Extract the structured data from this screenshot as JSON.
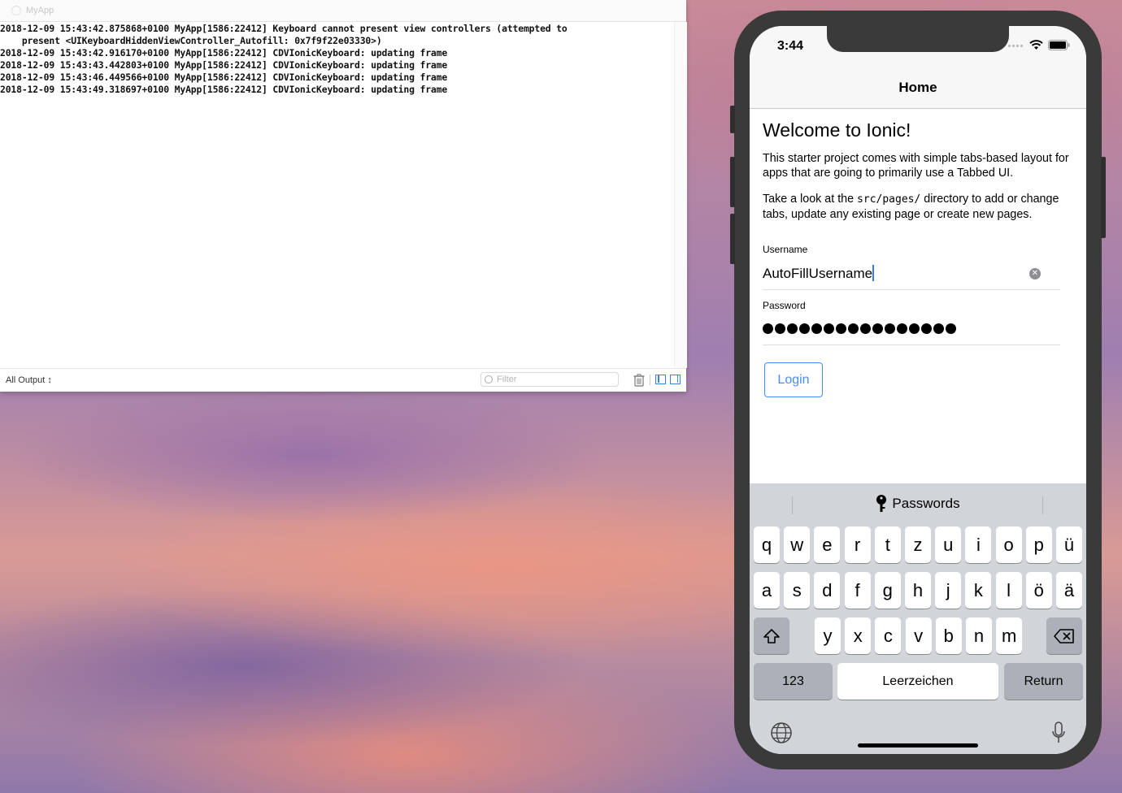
{
  "console": {
    "title": "MyApp",
    "log_lines": [
      "2018-12-09 15:43:42.875868+0100 MyApp[1586:22412] Keyboard cannot present view controllers (attempted to",
      "    present <UIKeyboardHiddenViewController_Autofill: 0x7f9f22e03330>)",
      "2018-12-09 15:43:42.916170+0100 MyApp[1586:22412] CDVIonicKeyboard: updating frame",
      "2018-12-09 15:43:43.442803+0100 MyApp[1586:22412] CDVIonicKeyboard: updating frame",
      "2018-12-09 15:43:46.449566+0100 MyApp[1586:22412] CDVIonicKeyboard: updating frame",
      "2018-12-09 15:43:49.318697+0100 MyApp[1586:22412] CDVIonicKeyboard: updating frame"
    ],
    "output_select": "All Output ↕",
    "filter_placeholder": "Filter",
    "accent_color": "#3d85d8"
  },
  "phone": {
    "time": "3:44",
    "nav_title": "Home",
    "heading": "Welcome to Ionic!",
    "para1": "This starter project comes with simple tabs-based layout for apps that are going to primarily use a Tabbed UI.",
    "para2_prefix": "Take a look at the ",
    "para2_code": "src/pages/",
    "para2_suffix": " directory to add or change tabs, update any existing page or create new pages.",
    "username_label": "Username",
    "username_value": "AutoFillUsername",
    "password_label": "Password",
    "password_dot_count": 16,
    "login_label": "Login",
    "accent_color": "#488aff"
  },
  "keyboard": {
    "passwords_label": "Passwords",
    "row1": [
      "q",
      "w",
      "e",
      "r",
      "t",
      "z",
      "u",
      "i",
      "o",
      "p",
      "ü"
    ],
    "row2": [
      "a",
      "s",
      "d",
      "f",
      "g",
      "h",
      "j",
      "k",
      "l",
      "ö",
      "ä"
    ],
    "row3": [
      "y",
      "x",
      "c",
      "v",
      "b",
      "n",
      "m"
    ],
    "numbers_label": "123",
    "space_label": "Leerzeichen",
    "return_label": "Return",
    "icons": [
      "key-icon",
      "shift-icon",
      "backspace-icon",
      "globe-icon",
      "microphone-icon"
    ]
  }
}
